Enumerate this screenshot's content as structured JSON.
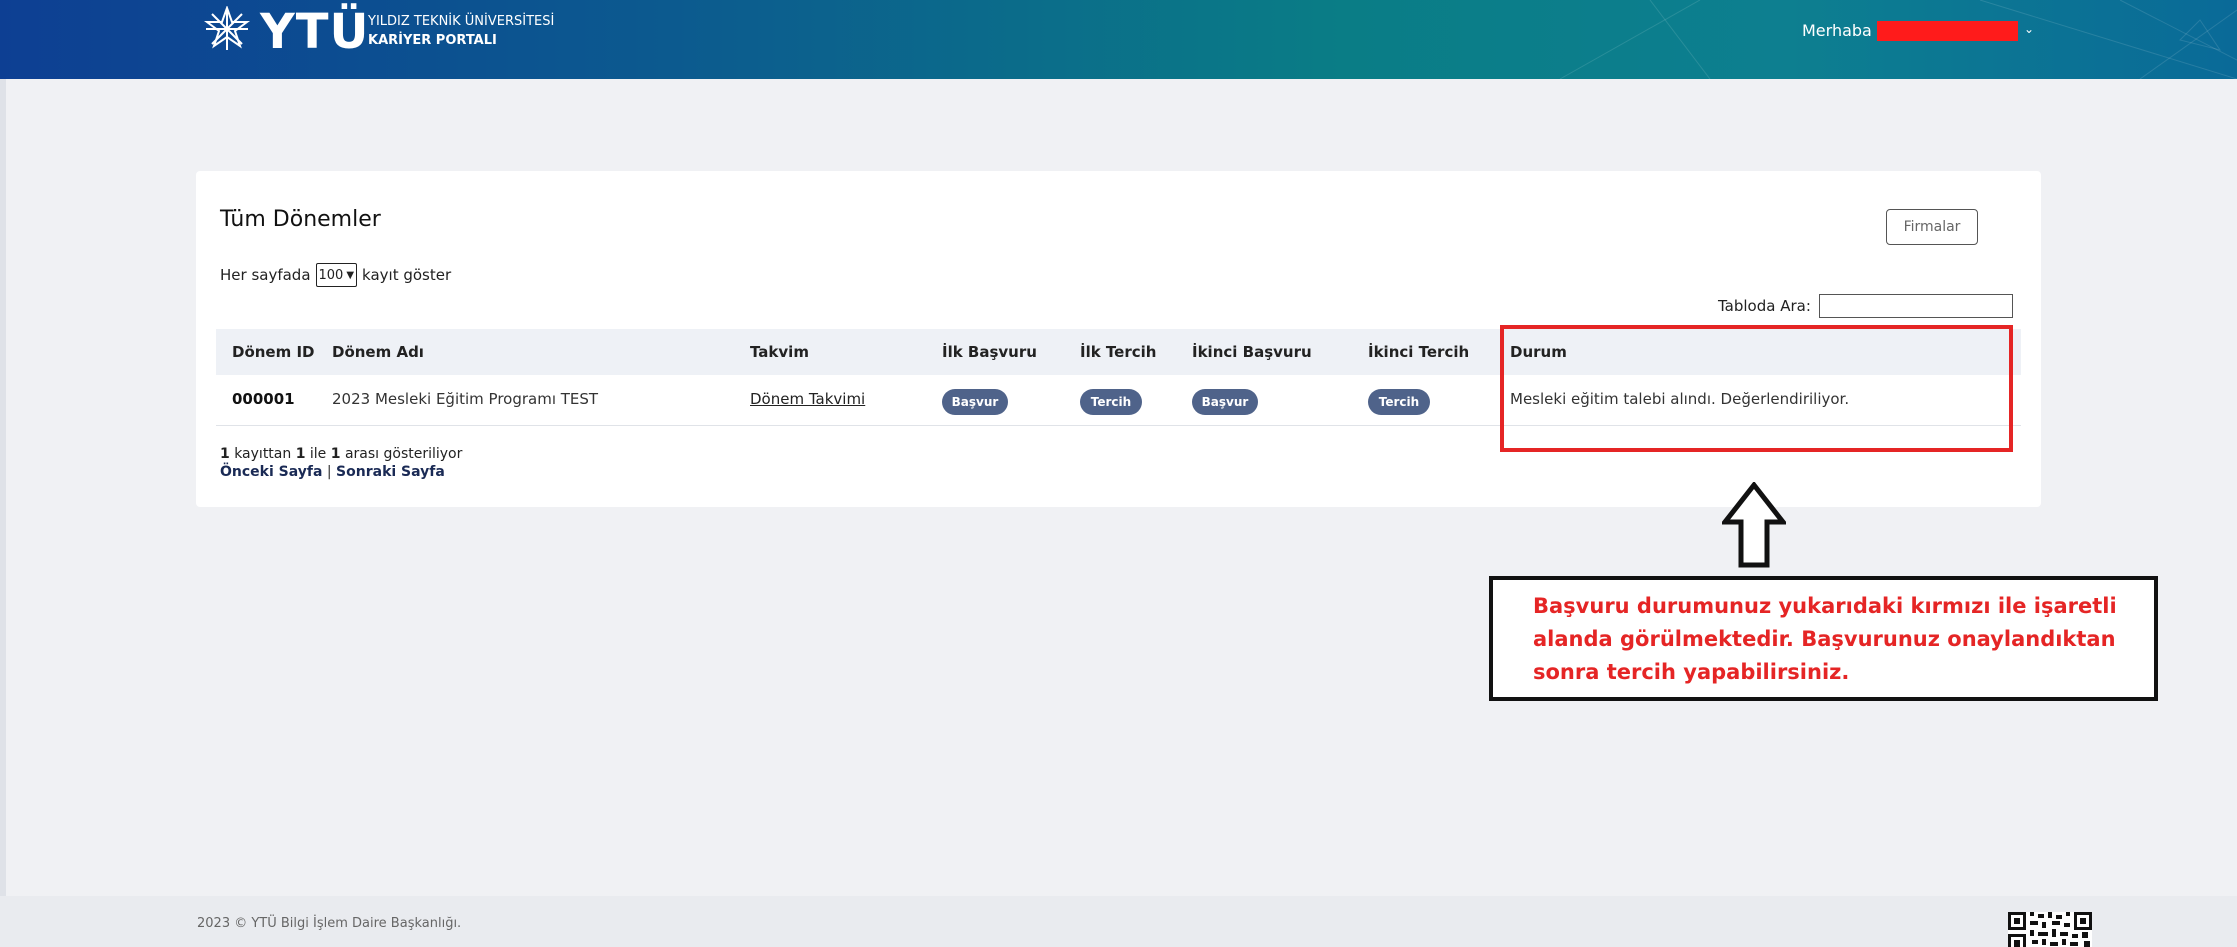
{
  "header": {
    "logo_text": "YTÜ",
    "university_line1": "YILDIZ TEKNİK ÜNİVERSİTESİ",
    "university_line2": "KARİYER PORTALI",
    "greeting": "Merhaba",
    "user_menu_icon": "chevron-down-icon"
  },
  "card": {
    "title": "Tüm Dönemler",
    "firmalar_button": "Firmalar",
    "length_prefix": "Her sayfada",
    "length_value": "100",
    "length_suffix": "kayıt göster",
    "search_label": "Tabloda Ara:",
    "search_value": ""
  },
  "table": {
    "columns": [
      "Dönem ID",
      "Dönem Adı",
      "Takvim",
      "İlk Başvuru",
      "İlk Tercih",
      "İkinci Başvuru",
      "İkinci Tercih",
      "Durum"
    ],
    "rows": [
      {
        "id": "000001",
        "name": "2023 Mesleki Eğitim Programı TEST",
        "calendar": "Dönem Takvimi",
        "first_apply": "Başvur",
        "first_pref": "Tercih",
        "second_apply": "Başvur",
        "second_pref": "Tercih",
        "status": "Mesleki eğitim talebi alındı. Değerlendiriliyor."
      }
    ]
  },
  "info": {
    "n1": "1",
    "t1": " kayıttan ",
    "n2": "1",
    "t2": " ile ",
    "n3": "1",
    "t3": " arası gösteriliyor"
  },
  "pager": {
    "prev": "Önceki Sayfa",
    "separator": " | ",
    "next": "Sonraki Sayfa"
  },
  "annotation": {
    "arrow_icon": "up-arrow-icon",
    "note": "Başvuru durumunuz yukarıdaki kırmızı ile işaretli alanda görülmektedir. Başvurunuz onaylandıktan sonra tercih yapabilirsiniz."
  },
  "footer": {
    "copyright": "2023 © YTÜ Bilgi İşlem Daire Başkanlığı."
  },
  "colors": {
    "header_start": "#0d3f93",
    "header_end": "#0a7d86",
    "pill": "#4f638a",
    "highlight_red": "#e52525"
  }
}
